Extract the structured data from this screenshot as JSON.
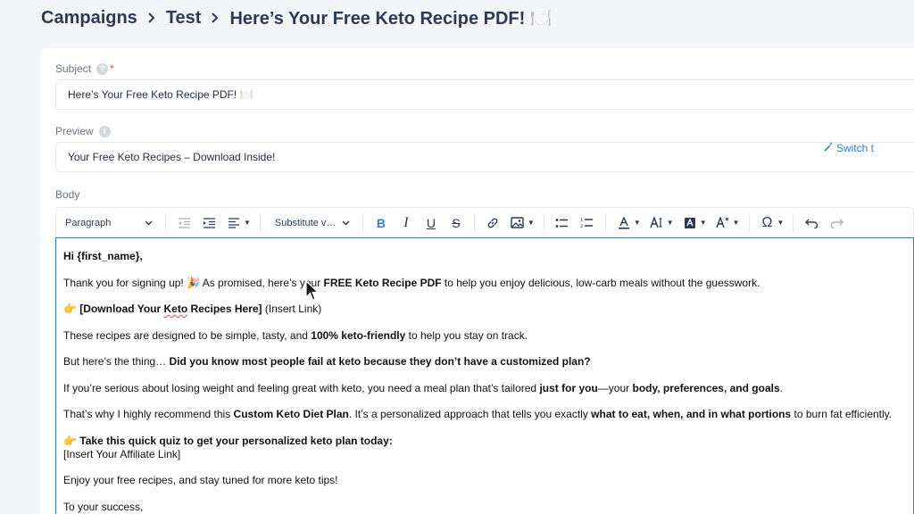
{
  "breadcrumb": {
    "items": [
      "Campaigns",
      "Test",
      "Here’s Your Free Keto Recipe PDF! 🍽️"
    ]
  },
  "form": {
    "subject_label": "Subject",
    "subject_required": "*",
    "subject_value": "Here’s Your Free Keto Recipe PDF! 🍽️",
    "preview_label": "Preview",
    "preview_value": "Your Free Keto Recipes – Download Inside!",
    "body_label": "Body",
    "switch_label": "Switch t"
  },
  "toolbar": {
    "paragraph_select": "Paragraph",
    "substitute_select": "Substitute v…",
    "icons": [
      "outdent-icon",
      "indent-icon",
      "align-icon",
      "bold-icon",
      "italic-icon",
      "underline-icon",
      "strikethrough-icon",
      "link-icon",
      "image-icon",
      "bullet-list-icon",
      "numbered-list-icon",
      "text-color-icon",
      "font-size-icon",
      "highlight-icon",
      "text-format-icon",
      "special-char-icon",
      "undo-icon",
      "redo-icon"
    ],
    "accent": "#2f7fd8"
  },
  "body": {
    "greeting": "Hi {first_name},",
    "p1_a": "Thank you for signing up! 🎉 As promised, here’s your ",
    "p1_b": "FREE Keto Recipe PDF",
    "p1_c": " to help you enjoy delicious, low-carb meals without the guesswork.",
    "p2_emoji": "👉 ",
    "p2_a": "[Download Your ",
    "p2_keto": "Keto",
    "p2_b": " Recipes Here]",
    "p2_c": " (Insert Link)",
    "p3_a": "These recipes are designed to be simple, tasty, and ",
    "p3_b": "100% keto-friendly",
    "p3_c": " to help you stay on track.",
    "p4_a": "But here’s the thing… ",
    "p4_b": "Did you know most people fail at keto because they don’t have a customized plan?",
    "p5_a": "If you’re serious about losing weight and feeling great with keto, you need a meal plan that’s tailored ",
    "p5_b": "just for you",
    "p5_c": "—your ",
    "p5_d": "body, preferences, and goals",
    "p5_e": ".",
    "p6_a": "That’s why I highly recommend this ",
    "p6_b": "Custom Keto Diet Plan",
    "p6_c": ". It’s a personalized approach that tells you exactly ",
    "p6_d": "what to eat, when, and in what portions",
    "p6_e": " to burn fat efficiently.",
    "p7_emoji": "👉 ",
    "p7_a": "Take this quick quiz to get your personalized keto plan today:",
    "p7_b": "[Insert Your Affiliate Link]",
    "p8": "Enjoy your free recipes, and stay tuned for more keto tips!",
    "p9": "To your success,"
  }
}
